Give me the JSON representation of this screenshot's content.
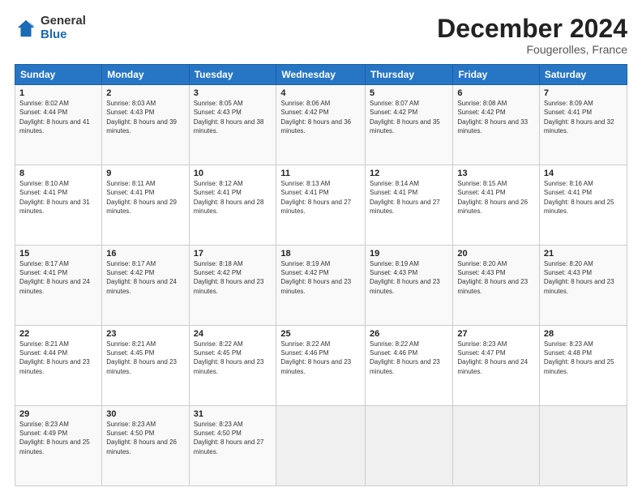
{
  "logo": {
    "general": "General",
    "blue": "Blue"
  },
  "title": "December 2024",
  "location": "Fougerolles, France",
  "days_header": [
    "Sunday",
    "Monday",
    "Tuesday",
    "Wednesday",
    "Thursday",
    "Friday",
    "Saturday"
  ],
  "weeks": [
    [
      {
        "day": "1",
        "sunrise": "8:02 AM",
        "sunset": "4:44 PM",
        "daylight": "8 hours and 41 minutes."
      },
      {
        "day": "2",
        "sunrise": "8:03 AM",
        "sunset": "4:43 PM",
        "daylight": "8 hours and 39 minutes."
      },
      {
        "day": "3",
        "sunrise": "8:05 AM",
        "sunset": "4:43 PM",
        "daylight": "8 hours and 38 minutes."
      },
      {
        "day": "4",
        "sunrise": "8:06 AM",
        "sunset": "4:42 PM",
        "daylight": "8 hours and 36 minutes."
      },
      {
        "day": "5",
        "sunrise": "8:07 AM",
        "sunset": "4:42 PM",
        "daylight": "8 hours and 35 minutes."
      },
      {
        "day": "6",
        "sunrise": "8:08 AM",
        "sunset": "4:42 PM",
        "daylight": "8 hours and 33 minutes."
      },
      {
        "day": "7",
        "sunrise": "8:09 AM",
        "sunset": "4:41 PM",
        "daylight": "8 hours and 32 minutes."
      }
    ],
    [
      {
        "day": "8",
        "sunrise": "8:10 AM",
        "sunset": "4:41 PM",
        "daylight": "8 hours and 31 minutes."
      },
      {
        "day": "9",
        "sunrise": "8:11 AM",
        "sunset": "4:41 PM",
        "daylight": "8 hours and 29 minutes."
      },
      {
        "day": "10",
        "sunrise": "8:12 AM",
        "sunset": "4:41 PM",
        "daylight": "8 hours and 28 minutes."
      },
      {
        "day": "11",
        "sunrise": "8:13 AM",
        "sunset": "4:41 PM",
        "daylight": "8 hours and 27 minutes."
      },
      {
        "day": "12",
        "sunrise": "8:14 AM",
        "sunset": "4:41 PM",
        "daylight": "8 hours and 27 minutes."
      },
      {
        "day": "13",
        "sunrise": "8:15 AM",
        "sunset": "4:41 PM",
        "daylight": "8 hours and 26 minutes."
      },
      {
        "day": "14",
        "sunrise": "8:16 AM",
        "sunset": "4:41 PM",
        "daylight": "8 hours and 25 minutes."
      }
    ],
    [
      {
        "day": "15",
        "sunrise": "8:17 AM",
        "sunset": "4:41 PM",
        "daylight": "8 hours and 24 minutes."
      },
      {
        "day": "16",
        "sunrise": "8:17 AM",
        "sunset": "4:42 PM",
        "daylight": "8 hours and 24 minutes."
      },
      {
        "day": "17",
        "sunrise": "8:18 AM",
        "sunset": "4:42 PM",
        "daylight": "8 hours and 23 minutes."
      },
      {
        "day": "18",
        "sunrise": "8:19 AM",
        "sunset": "4:42 PM",
        "daylight": "8 hours and 23 minutes."
      },
      {
        "day": "19",
        "sunrise": "8:19 AM",
        "sunset": "4:43 PM",
        "daylight": "8 hours and 23 minutes."
      },
      {
        "day": "20",
        "sunrise": "8:20 AM",
        "sunset": "4:43 PM",
        "daylight": "8 hours and 23 minutes."
      },
      {
        "day": "21",
        "sunrise": "8:20 AM",
        "sunset": "4:43 PM",
        "daylight": "8 hours and 23 minutes."
      }
    ],
    [
      {
        "day": "22",
        "sunrise": "8:21 AM",
        "sunset": "4:44 PM",
        "daylight": "8 hours and 23 minutes."
      },
      {
        "day": "23",
        "sunrise": "8:21 AM",
        "sunset": "4:45 PM",
        "daylight": "8 hours and 23 minutes."
      },
      {
        "day": "24",
        "sunrise": "8:22 AM",
        "sunset": "4:45 PM",
        "daylight": "8 hours and 23 minutes."
      },
      {
        "day": "25",
        "sunrise": "8:22 AM",
        "sunset": "4:46 PM",
        "daylight": "8 hours and 23 minutes."
      },
      {
        "day": "26",
        "sunrise": "8:22 AM",
        "sunset": "4:46 PM",
        "daylight": "8 hours and 23 minutes."
      },
      {
        "day": "27",
        "sunrise": "8:23 AM",
        "sunset": "4:47 PM",
        "daylight": "8 hours and 24 minutes."
      },
      {
        "day": "28",
        "sunrise": "8:23 AM",
        "sunset": "4:48 PM",
        "daylight": "8 hours and 25 minutes."
      }
    ],
    [
      {
        "day": "29",
        "sunrise": "8:23 AM",
        "sunset": "4:49 PM",
        "daylight": "8 hours and 25 minutes."
      },
      {
        "day": "30",
        "sunrise": "8:23 AM",
        "sunset": "4:50 PM",
        "daylight": "8 hours and 26 minutes."
      },
      {
        "day": "31",
        "sunrise": "8:23 AM",
        "sunset": "4:50 PM",
        "daylight": "8 hours and 27 minutes."
      },
      null,
      null,
      null,
      null
    ]
  ],
  "labels": {
    "sunrise": "Sunrise:",
    "sunset": "Sunset:",
    "daylight": "Daylight:"
  }
}
